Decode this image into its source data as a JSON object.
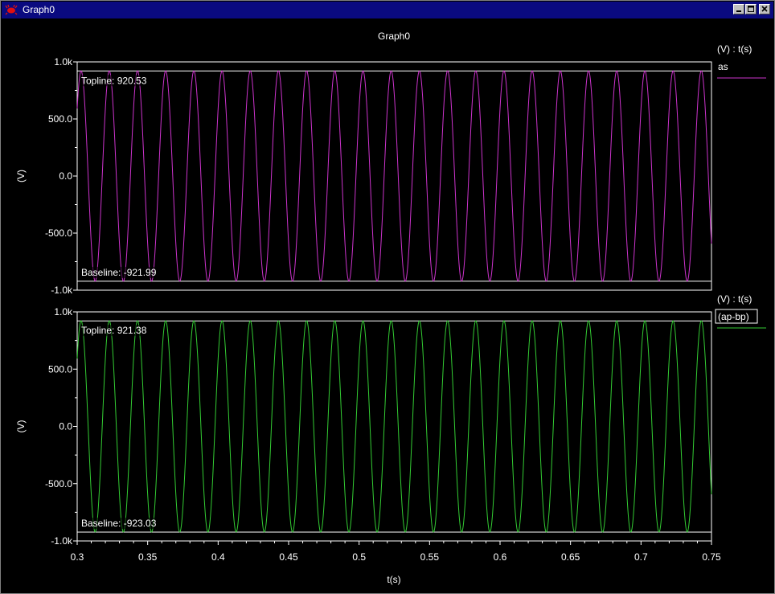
{
  "window": {
    "title": "Graph0",
    "icon": "red-bug-icon",
    "controls": [
      "minimize-icon",
      "maximize-icon",
      "close-icon"
    ]
  },
  "chart_data": {
    "title": "Graph0",
    "xlabel": "t(s)",
    "x_ticks": [
      "0.3",
      "0.35",
      "0.4",
      "0.45",
      "0.5",
      "0.55",
      "0.6",
      "0.65",
      "0.7",
      "0.75"
    ],
    "xlim": [
      0.3,
      0.75
    ],
    "grid": false,
    "background": "#000000",
    "panels": [
      {
        "type": "line",
        "ylabel": "(V)",
        "y_ticks": [
          "1.0k",
          "500.0",
          "0.0",
          "-500.0",
          "-1.0k"
        ],
        "ylim": [
          -1000,
          1000
        ],
        "legend_header": "(V) : t(s)",
        "series": [
          {
            "name": "as",
            "color": "#cc33cc",
            "waveform": "sine",
            "frequency_hz": 50,
            "amplitude": 921,
            "max": 920.53,
            "min": -921.99,
            "phase_deg": 40
          }
        ],
        "topline_label": "Topline: 920.53",
        "topline_value": 920.53,
        "baseline_label": "Baseline: -921.99",
        "baseline_value": -921.99
      },
      {
        "type": "line",
        "ylabel": "(V)",
        "y_ticks": [
          "1.0k",
          "500.0",
          "0.0",
          "-500.0",
          "-1.0k"
        ],
        "ylim": [
          -1000,
          1000
        ],
        "legend_header": "(V) : t(s)",
        "series": [
          {
            "name": "(ap-bp)",
            "color": "#33cc33",
            "waveform": "sine",
            "frequency_hz": 50,
            "amplitude": 922,
            "max": 921.38,
            "min": -923.03,
            "phase_deg": 40
          }
        ],
        "topline_label": "Topline: 921.38",
        "topline_value": 921.38,
        "baseline_label": "Baseline: -923.03",
        "baseline_value": -923.03
      }
    ]
  }
}
